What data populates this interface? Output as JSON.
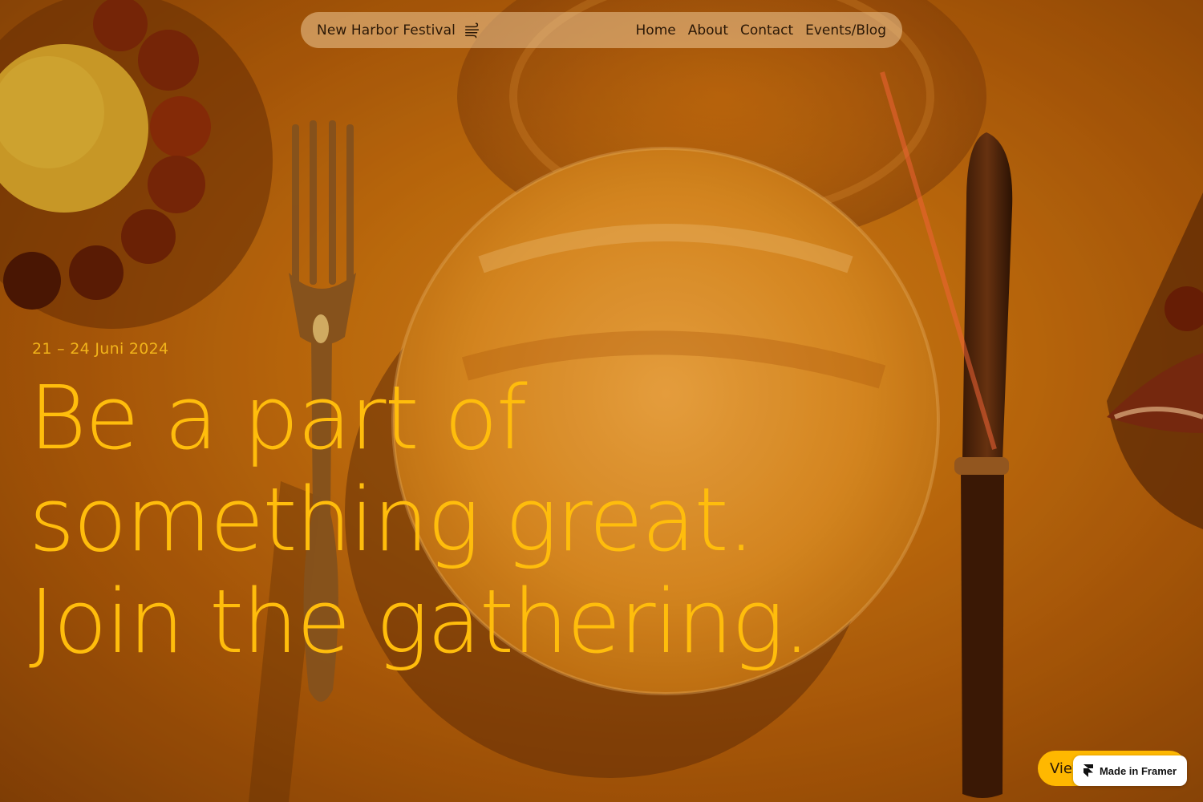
{
  "nav": {
    "brand": "New Harbor Festival",
    "brand_icon": "wind-icon",
    "links": [
      "Home",
      "About",
      "Contact",
      "Events/Blog"
    ]
  },
  "hero": {
    "date": "21 – 24 Juni 2024",
    "headline": "Be a part of something great. Join the gathering."
  },
  "cta": {
    "label": "View"
  },
  "badge": {
    "label": "Made in Framer",
    "icon": "framer-logo-icon"
  },
  "colors": {
    "accent": "#ffbd0c",
    "button": "#ffb800",
    "nav_text": "#2b1806",
    "nav_pill": "#eec896"
  }
}
